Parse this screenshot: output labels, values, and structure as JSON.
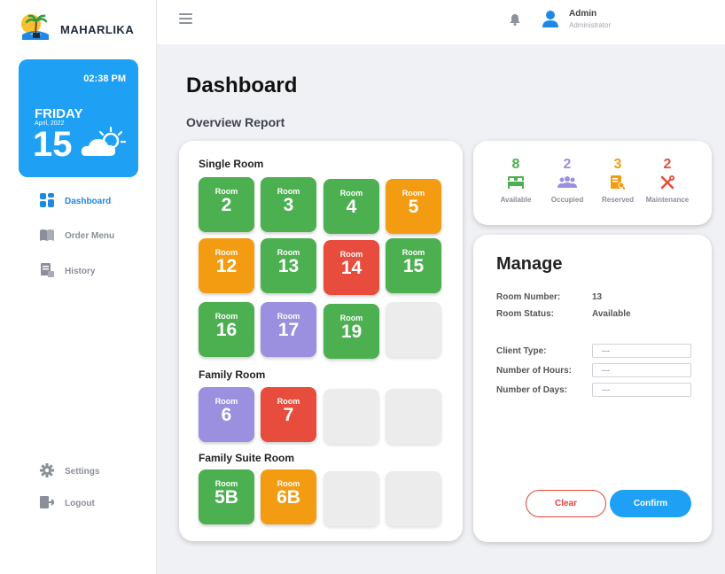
{
  "brand": {
    "name": "MAHARLIKA",
    "logo_icon": "island-logo-icon"
  },
  "date_card": {
    "time": "02:38 PM",
    "weekday": "FRIDAY",
    "month_year": "April, 2022",
    "day": "15",
    "weather_icon": "partly-cloudy-icon",
    "color": "#1ea0f5"
  },
  "sidebar": {
    "items": [
      {
        "label": "Dashboard",
        "icon": "dashboard-icon",
        "active": true
      },
      {
        "label": "Order Menu",
        "icon": "book-icon"
      },
      {
        "label": "History",
        "icon": "history-icon"
      }
    ],
    "bottom": [
      {
        "label": "Settings",
        "icon": "gear-icon"
      },
      {
        "label": "Logout",
        "icon": "logout-icon"
      }
    ]
  },
  "topbar": {
    "user_name": "Admin",
    "user_role": "Administrator",
    "menu_icon": "hamburger-icon",
    "notif_icon": "bell-icon",
    "avatar_icon": "user-avatar-icon"
  },
  "page": {
    "title": "Dashboard",
    "subtitle": "Overview Report"
  },
  "colors": {
    "available": "#4caf50",
    "occupied": "#9b8fe0",
    "reserved": "#f39c12",
    "maintenance": "#e74c3c",
    "accent": "#1ea0f5"
  },
  "rooms": {
    "room_word": "Room",
    "single": {
      "title": "Single Room",
      "items": [
        {
          "number": "2",
          "status": "available"
        },
        {
          "number": "3",
          "status": "available"
        },
        {
          "number": "4",
          "status": "available"
        },
        {
          "number": "5",
          "status": "reserved"
        },
        {
          "number": "12",
          "status": "reserved"
        },
        {
          "number": "13",
          "status": "available"
        },
        {
          "number": "14",
          "status": "maintenance"
        },
        {
          "number": "15",
          "status": "available"
        },
        {
          "number": "16",
          "status": "available"
        },
        {
          "number": "17",
          "status": "occupied"
        },
        {
          "number": "19",
          "status": "available"
        }
      ]
    },
    "family": {
      "title": "Family Room",
      "items": [
        {
          "number": "6",
          "status": "occupied"
        },
        {
          "number": "7",
          "status": "maintenance"
        }
      ]
    },
    "suite": {
      "title": "Family Suite Room",
      "items": [
        {
          "number": "5B",
          "status": "available"
        },
        {
          "number": "6B",
          "status": "reserved"
        }
      ]
    }
  },
  "stats": [
    {
      "count": "8",
      "label": "Available",
      "icon": "bed-icon",
      "color": "#4caf50"
    },
    {
      "count": "2",
      "label": "Occupied",
      "icon": "people-icon",
      "color": "#9b8fe0"
    },
    {
      "count": "3",
      "label": "Reserved",
      "icon": "reserved-document-icon",
      "color": "#f39c12"
    },
    {
      "count": "2",
      "label": "Maintenance",
      "icon": "tools-icon",
      "color": "#e74c3c"
    }
  ],
  "manage": {
    "title": "Manage",
    "room_number_label": "Room Number:",
    "room_number": "13",
    "room_status_label": "Room Status:",
    "room_status": "Available",
    "client_type_label": "Client Type:",
    "client_type": "---",
    "hours_label": "Number of Hours:",
    "hours": "---",
    "days_label": "Number of Days:",
    "days": "---",
    "clear_label": "Clear",
    "confirm_label": "Confirm"
  }
}
